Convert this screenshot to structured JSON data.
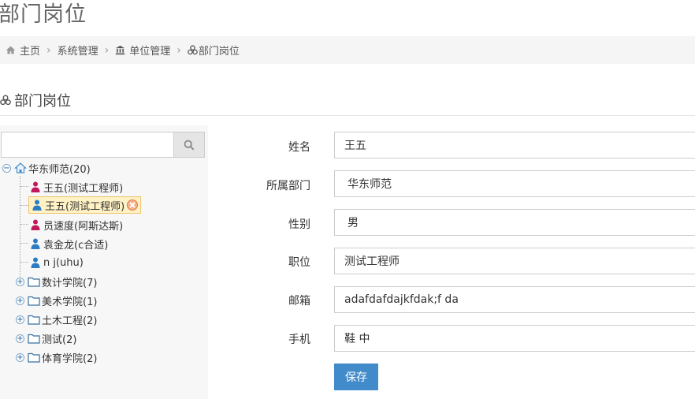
{
  "page": {
    "title": "部门岗位"
  },
  "breadcrumb": [
    {
      "label": "主页",
      "icon": "home-icon"
    },
    {
      "label": "系统管理"
    },
    {
      "label": "单位管理",
      "icon": "bank-icon"
    },
    {
      "label": "部门岗位",
      "icon": "cubes-icon"
    }
  ],
  "section": {
    "title": "部门岗位",
    "icon": "cubes-icon"
  },
  "search": {
    "value": "",
    "placeholder": "",
    "button_icon": "search-icon"
  },
  "tree": {
    "root": {
      "label": "华东师范(20)",
      "icon": "home-icon",
      "expanded": true
    },
    "users": [
      {
        "label": "王五(测试工程师)",
        "icon": "user-female-icon",
        "color": "#c2185b"
      },
      {
        "label": "王五(测试工程师)",
        "icon": "user-icon",
        "color": "#2a7dc4",
        "selected": true
      },
      {
        "label": "员速度(阿斯达斯)",
        "icon": "user-female-icon",
        "color": "#c2185b"
      },
      {
        "label": "袁金龙(c合适)",
        "icon": "user-icon",
        "color": "#2a7dc4"
      },
      {
        "label": "n j(uhu)",
        "icon": "user-icon",
        "color": "#2a7dc4"
      }
    ],
    "folders": [
      {
        "label": "数计学院(7)",
        "icon": "folder-icon"
      },
      {
        "label": "美术学院(1)",
        "icon": "folder-icon"
      },
      {
        "label": "土木工程(2)",
        "icon": "folder-icon"
      },
      {
        "label": "测试(2)",
        "icon": "folder-icon"
      },
      {
        "label": "体育学院(2)",
        "icon": "folder-icon"
      }
    ]
  },
  "form": {
    "name": {
      "label": "姓名",
      "value": "王五"
    },
    "department": {
      "label": "所属部门",
      "value": "华东师范"
    },
    "gender": {
      "label": "性别",
      "value": "男"
    },
    "position": {
      "label": "职位",
      "value": "测试工程师"
    },
    "email": {
      "label": "邮箱",
      "value": "adafdafdajkfdak;f da"
    },
    "phone": {
      "label": "手机",
      "value": "鞋 中"
    },
    "save_label": "保存"
  },
  "colors": {
    "accent": "#428bca",
    "female": "#c2185b",
    "male": "#2a7dc4",
    "selected_bg": "#fff2c5"
  }
}
